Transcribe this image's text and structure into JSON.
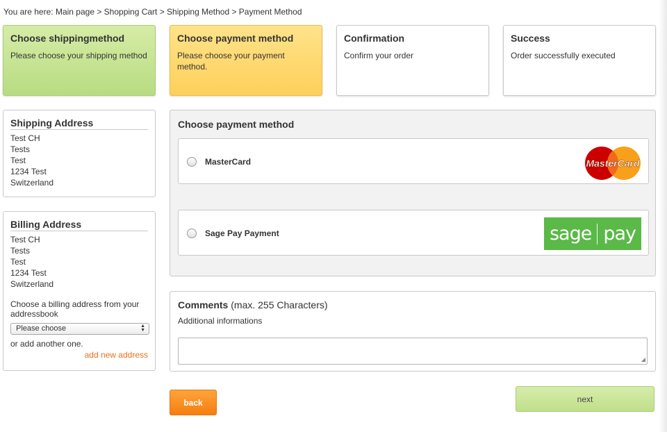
{
  "breadcrumb": {
    "text": "You are here: Main page > Shopping Cart > Shipping Method > Payment Method"
  },
  "steps": [
    {
      "title": "Choose shippingmethod",
      "desc": "Please choose your shipping method"
    },
    {
      "title": "Choose payment method",
      "desc": "Please choose your payment method."
    },
    {
      "title": "Confirmation",
      "desc": "Confirm your order"
    },
    {
      "title": "Success",
      "desc": "Order successfully executed"
    }
  ],
  "shipping": {
    "title": "Shipping Address",
    "lines": [
      "Test CH",
      "Tests",
      "Test",
      "1234 Test",
      "Switzerland"
    ]
  },
  "billing": {
    "title": "Billing Address",
    "lines": [
      "Test CH",
      "Tests",
      "Test",
      "1234 Test",
      "Switzerland"
    ],
    "choose_text": "Choose a billing address from your addressbook",
    "select_value": "Please choose",
    "or_text": "or add another one.",
    "add_link": "add new address"
  },
  "payment": {
    "title": "Choose payment method",
    "options": [
      {
        "label": "MasterCard",
        "logo": "mastercard-logo",
        "logo_text": "MasterCard"
      },
      {
        "label": "Sage Pay Payment",
        "logo": "sagepay-logo",
        "logo_text_left": "sage",
        "logo_text_right": "pay"
      }
    ]
  },
  "comments": {
    "title": "Comments",
    "title_suffix": "(max. 255 Characters)",
    "subtitle": "Additional informations"
  },
  "buttons": {
    "back": "back",
    "next": "next"
  },
  "colors": {
    "done_step": "#c5e393",
    "active_step": "#fdd96c",
    "link_orange": "#e8701a",
    "back_button": "#f68a1f",
    "next_button": "#c9e59a",
    "sagepay_green": "#5ab947"
  }
}
